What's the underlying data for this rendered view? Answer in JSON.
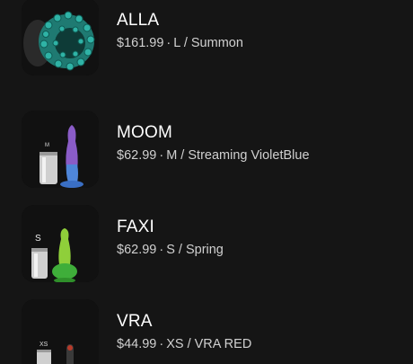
{
  "products": [
    {
      "name": "ALLA",
      "price": "$161.99",
      "separator": "·",
      "variant": "L / Summon",
      "image_icon": "green-tentacle-ring-image"
    },
    {
      "name": "MOOM",
      "price": "$62.99",
      "separator": "·",
      "variant": "M / Streaming VioletBlue",
      "size_tag": "M",
      "image_icon": "violet-blue-toy-with-can-image"
    },
    {
      "name": "FAXI",
      "price": "$62.99",
      "separator": "·",
      "variant": "S / Spring",
      "size_tag": "S",
      "image_icon": "green-toy-with-can-image"
    },
    {
      "name": "VRA",
      "price": "$44.99",
      "separator": "·",
      "variant": "XS / VRA RED",
      "size_tag": "XS",
      "image_icon": "red-toy-with-can-image"
    }
  ],
  "colors": {
    "background": "#151515",
    "thumb_background": "#0c0c0c",
    "title": "#ffffff",
    "meta": "#d0d0d0"
  }
}
